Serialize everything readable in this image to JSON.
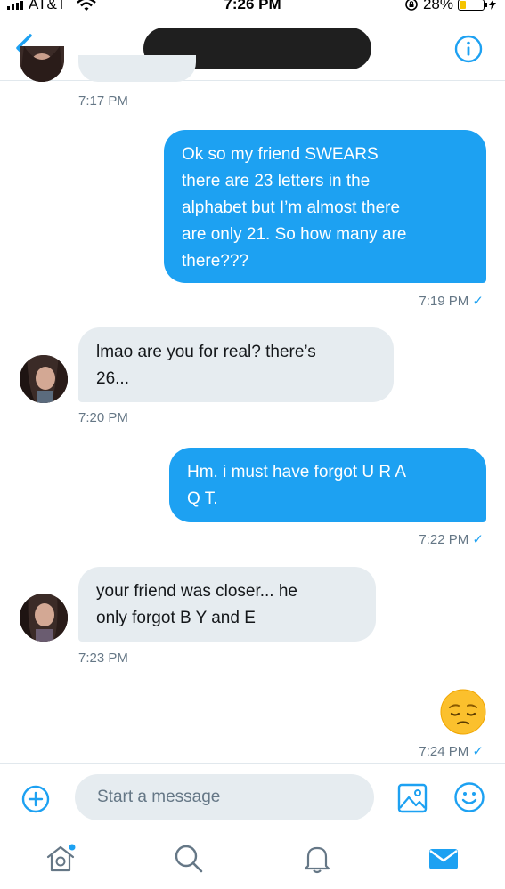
{
  "status_bar": {
    "carrier": "AT&T",
    "time": "7:26 PM",
    "battery": "28%"
  },
  "header": {
    "title": ""
  },
  "messages": [
    {
      "side": "in",
      "text": "",
      "time": "7:17 PM"
    },
    {
      "side": "out",
      "lines": [
        "Ok so my friend SWEARS",
        "there are 23 letters in the",
        "alphabet but I’m almost there",
        "are only 21. So how many are",
        "there???"
      ],
      "time": "7:19 PM"
    },
    {
      "side": "in",
      "lines": [
        "lmao are you for real? there’s",
        "26..."
      ],
      "time": "7:20 PM"
    },
    {
      "side": "out",
      "lines": [
        "Hm. i must have forgot U R A",
        "Q T."
      ],
      "time": "7:22 PM"
    },
    {
      "side": "in",
      "lines": [
        "your friend was closer... he",
        "only forgot B Y and E"
      ],
      "time": "7:23 PM"
    },
    {
      "side": "out",
      "emoji": "pensive-face",
      "time": "7:24 PM"
    }
  ],
  "composer": {
    "placeholder": "Start a message"
  },
  "tabs": [
    "home",
    "search",
    "notifications",
    "messages"
  ],
  "colors": {
    "accent": "#1da1f2",
    "incoming_bubble": "#e6ecf0",
    "muted": "#657786"
  }
}
